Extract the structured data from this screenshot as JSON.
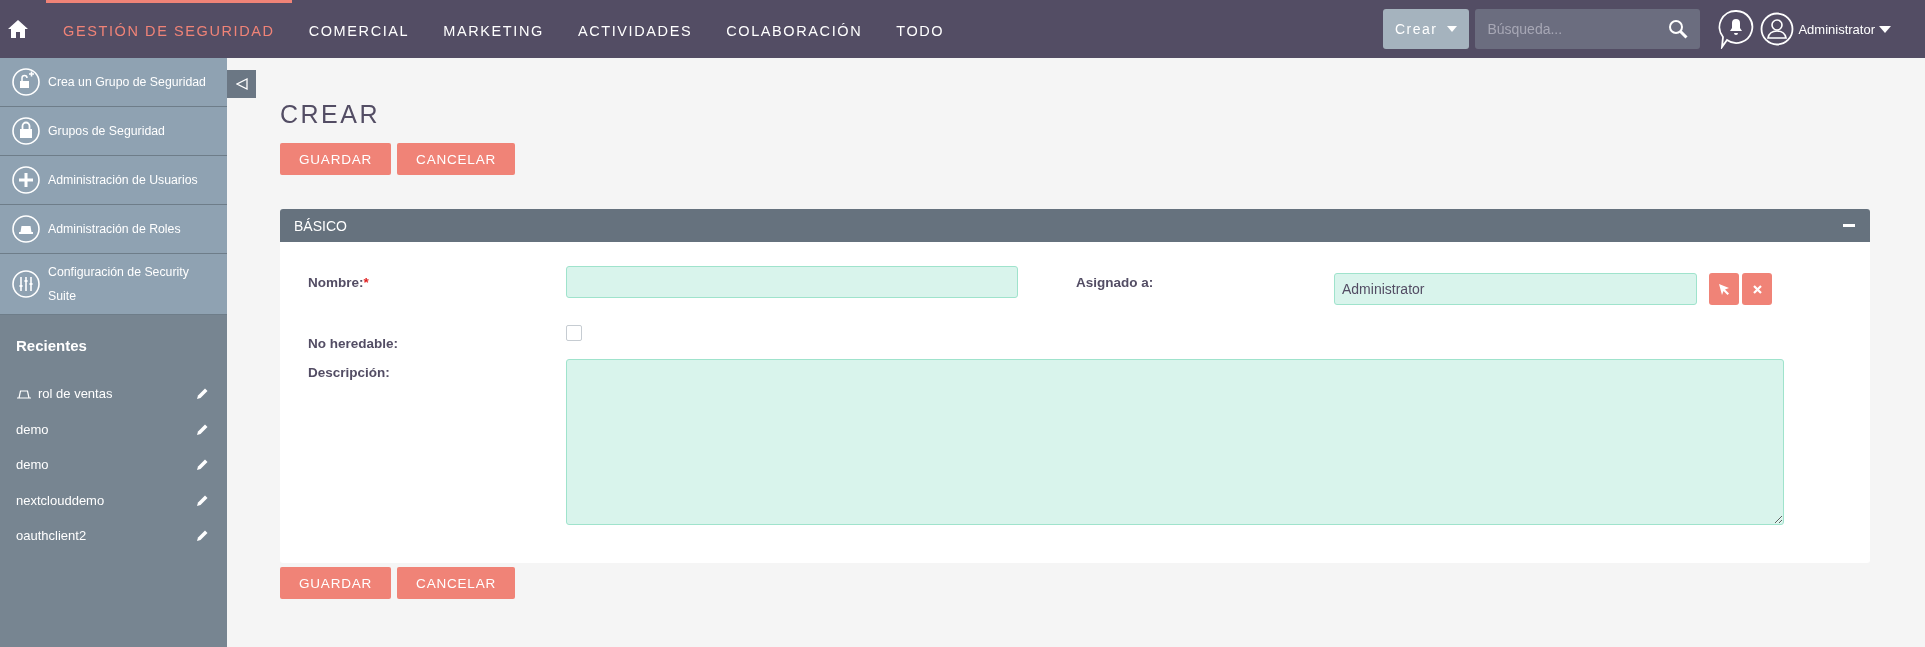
{
  "nav": {
    "tabs": [
      {
        "label": "GESTIÓN DE SEGURIDAD",
        "selected": true
      },
      {
        "label": "COMERCIAL",
        "selected": false
      },
      {
        "label": "MARKETING",
        "selected": false
      },
      {
        "label": "ACTIVIDADES",
        "selected": false
      },
      {
        "label": "COLABORACIÓN",
        "selected": false
      },
      {
        "label": "TODO",
        "selected": false
      }
    ],
    "create_button": "Crear",
    "search": {
      "placeholder": "Búsqueda..."
    },
    "user": "Administrator"
  },
  "sidebar": {
    "actions": [
      {
        "label": "Crea un Grupo de Seguridad",
        "kind": "add-lock"
      },
      {
        "label": "Grupos de Seguridad",
        "kind": "lock"
      },
      {
        "label": "Administración de Usuarios",
        "kind": "plus"
      },
      {
        "label": "Administración de Roles",
        "kind": "hat"
      },
      {
        "label": "Configuración de Security Suite",
        "kind": "sliders"
      }
    ],
    "recent_title": "Recientes",
    "recent": [
      {
        "label": "rol de ventas",
        "kind": "role"
      },
      {
        "label": "demo",
        "kind": "plain"
      },
      {
        "label": "demo",
        "kind": "plain"
      },
      {
        "label": "nextclouddemo",
        "kind": "plain"
      },
      {
        "label": "oauthclient2",
        "kind": "plain"
      }
    ]
  },
  "page_title": "CREAR",
  "buttons": [
    "GUARDAR",
    "CANCELAR"
  ],
  "panel": {
    "title": "BÁSICO",
    "expanded": true,
    "fields": {
      "name_label": "Nombre:",
      "required_mark": "*",
      "assigned_label": "Asignado a:",
      "assigned_value": "Administrator",
      "no_inherit_label": "No heredable:",
      "no_inherit_checked": false,
      "description_label": "Descripción:"
    }
  },
  "bottom_buttons": [
    "GUARDAR",
    "CANCELAR"
  ]
}
